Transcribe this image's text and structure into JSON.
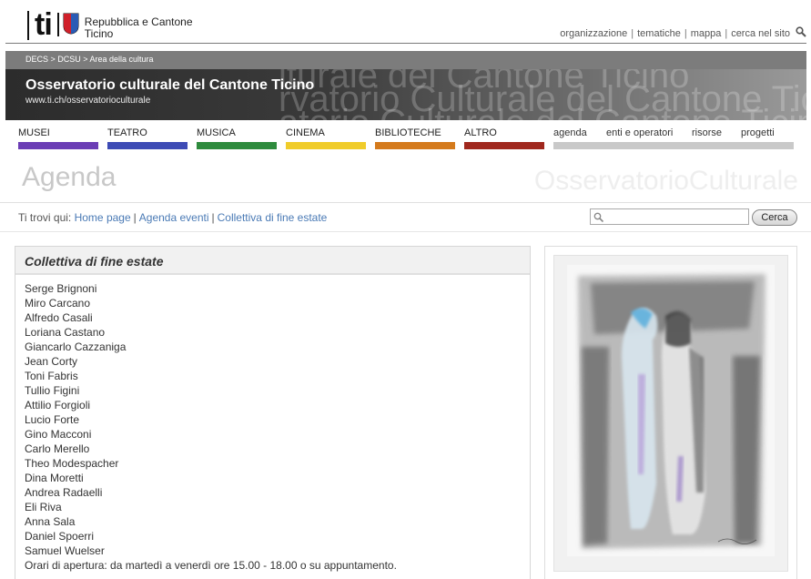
{
  "header": {
    "logo_mark": "ti",
    "logo_line1": "Repubblica e Cantone",
    "logo_line2": "Ticino",
    "nav": [
      "organizzazione",
      "tematiche",
      "mappa",
      "cerca nel sito"
    ]
  },
  "breadcrumb_bar": "DECS > DCSU > Area della cultura",
  "banner": {
    "title": "Osservatorio culturale del Cantone Ticino",
    "url": "www.ti.ch/osservatorioculturale",
    "background_text": [
      "lturale del Cantone Ticino",
      "rvatorio Culturale del Cantone Tic",
      "atorio Culturale del Cantone Ticino"
    ]
  },
  "categories": [
    {
      "label": "MUSEI",
      "color": "#6b3db5"
    },
    {
      "label": "TEATRO",
      "color": "#3d4bb5"
    },
    {
      "label": "MUSICA",
      "color": "#2e8b3d"
    },
    {
      "label": "CINEMA",
      "color": "#f0cc2a"
    },
    {
      "label": "BIBLIOTECHE",
      "color": "#d47a1c"
    },
    {
      "label": "ALTRO",
      "color": "#a0281e"
    }
  ],
  "secondary_nav": [
    "agenda",
    "enti e operatori",
    "risorse",
    "progetti"
  ],
  "page_title": "Agenda",
  "watermark_title": "OsservatorioCulturale",
  "path": {
    "prefix": "Ti trovi qui:",
    "items": [
      "Home page",
      "Agenda eventi",
      "Collettiva di fine estate"
    ]
  },
  "search": {
    "placeholder": "",
    "button": "Cerca"
  },
  "event": {
    "title": "Collettiva di fine estate",
    "artists": [
      "Serge Brignoni",
      "Miro Carcano",
      "Alfredo Casali",
      "Loriana Castano",
      "Giancarlo Cazzaniga",
      "Jean Corty",
      "Toni Fabris",
      "Tullio Figini",
      "Attilio Forgioli",
      "Lucio Forte",
      "Gino Macconi",
      "Carlo Merello",
      "Theo Modespacher",
      "Dina Moretti",
      "Andrea Radaelli",
      "Eli Riva",
      "Anna Sala",
      "Daniel Spoerri",
      "Samuel Wuelser"
    ],
    "hours": "Orari di apertura: da martedì a venerdì ore 15.00 - 18.00 o su appuntamento."
  }
}
